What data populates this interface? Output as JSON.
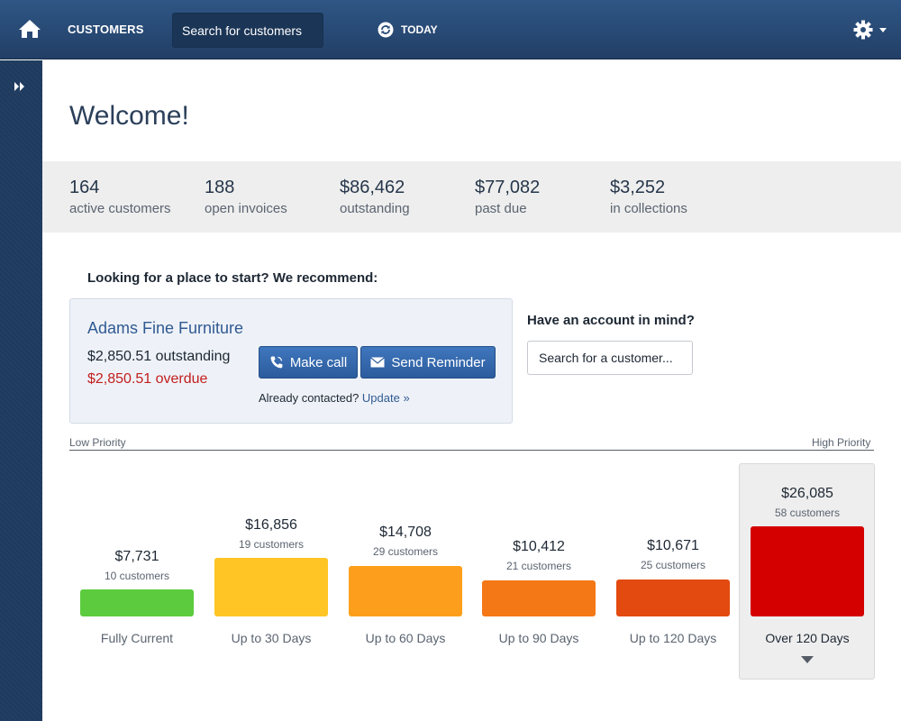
{
  "header": {
    "customers_label": "CUSTOMERS",
    "search_placeholder": "Search for customers",
    "today_label": "TODAY"
  },
  "welcome": "Welcome!",
  "stats": [
    {
      "value": "164",
      "label": "active customers"
    },
    {
      "value": "188",
      "label": "open invoices"
    },
    {
      "value": "$86,462",
      "label": "outstanding"
    },
    {
      "value": "$77,082",
      "label": "past due"
    },
    {
      "value": "$3,252",
      "label": "in collections"
    }
  ],
  "recommend": {
    "title": "Looking for a place to start? We recommend:",
    "customer_name": "Adams Fine Furniture",
    "outstanding": "$2,850.51 outstanding",
    "overdue": "$2,850.51 overdue",
    "call_label": "Make call",
    "reminder_label": "Send Reminder",
    "contacted_text": "Already contacted?",
    "update_link": "Update »"
  },
  "account": {
    "title": "Have an account in mind?",
    "search_placeholder": "Search for a customer..."
  },
  "priority": {
    "low": "Low Priority",
    "high": "High Priority"
  },
  "aging": [
    {
      "amount": "$7,731",
      "customers": "10 customers",
      "label": "Fully Current",
      "value": 7731,
      "color": "#5ccb3d"
    },
    {
      "amount": "$16,856",
      "customers": "19 customers",
      "label": "Up to 30 Days",
      "value": 16856,
      "color": "#fec524"
    },
    {
      "amount": "$14,708",
      "customers": "29 customers",
      "label": "Up to 60 Days",
      "value": 14708,
      "color": "#fd9f1c"
    },
    {
      "amount": "$10,412",
      "customers": "21 customers",
      "label": "Up to 90 Days",
      "value": 10412,
      "color": "#f57816"
    },
    {
      "amount": "$10,671",
      "customers": "25 customers",
      "label": "Up to 120 Days",
      "value": 10671,
      "color": "#e34a0f"
    },
    {
      "amount": "$26,085",
      "customers": "58 customers",
      "label": "Over 120 Days",
      "value": 26085,
      "color": "#d40000"
    }
  ],
  "colors": {
    "header": "#2a4d78",
    "sidebar": "#1e3a5e",
    "button": "#3466aa",
    "overdue": "#c21e1e",
    "link": "#315a92"
  },
  "icons": {
    "home": "home-icon",
    "today": "refresh-icon",
    "settings": "gear-icon",
    "sidebar": "double-chevron-right-icon",
    "call": "phone-icon",
    "reminder": "envelope-icon"
  }
}
